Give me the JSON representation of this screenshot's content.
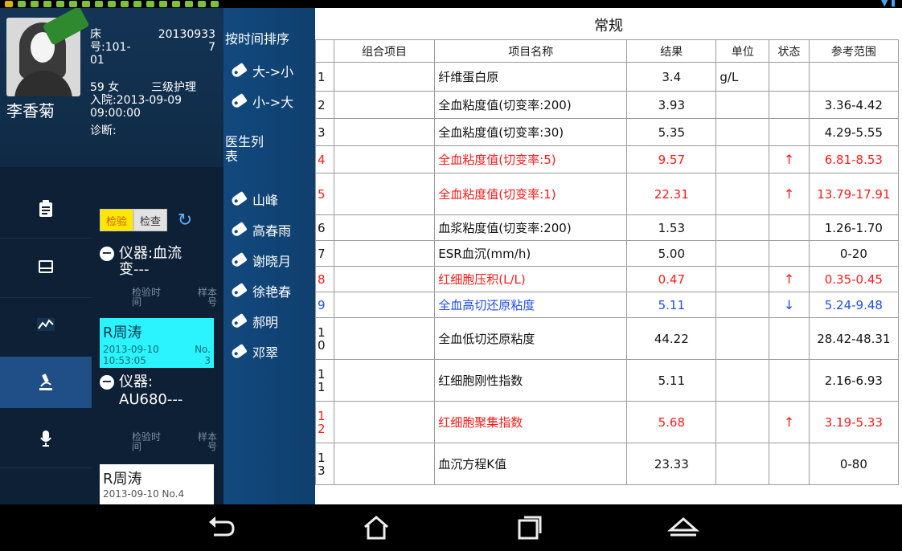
{
  "patient": {
    "name": "李香菊",
    "bed_label": "床",
    "bed_no": "号:101-",
    "bed_no2": "01",
    "pid": "20130933",
    "pid2": "7",
    "age_sex": "59 女",
    "care_level": "三级护理",
    "admit_label": "入院:2013-09-09",
    "admit_time": "09:00:00",
    "diagnosis_label": "诊断:"
  },
  "nav": {
    "icons": [
      "clipboard-icon",
      "inbox-icon",
      "trend-chart-icon",
      "microscope-icon",
      "microphone-icon"
    ]
  },
  "tests": {
    "tab_lab": "检验",
    "tab_exam": "检查",
    "instrument1_line1": "仪器:血流",
    "instrument1_line2": "变---",
    "instrument2_line1": "仪器:",
    "instrument2_line2": "AU680---",
    "col_time_1": "检验时",
    "col_time_2": "间",
    "col_sample_1": "样本",
    "col_sample_2": "号",
    "sample1": {
      "name": "R周涛",
      "date": "2013-09-10",
      "time": "10:53:05",
      "no1": "No.",
      "no2": "3"
    },
    "sample2": {
      "name": "R周涛",
      "date_partial": "2013-09-10 No.4"
    }
  },
  "filter": {
    "sort_title": "按时间排序",
    "sort_desc": "大->小",
    "sort_asc": "小->大",
    "doctor_title_1": "医生列",
    "doctor_title_2": "表",
    "doctors": [
      "山峰",
      "高春雨",
      "谢晓月",
      "徐艳春",
      "郝明",
      "邓翠"
    ]
  },
  "results": {
    "title": "常规",
    "headers": [
      "",
      "组合项目",
      "项目名称",
      "结果",
      "单位",
      "状态",
      "参考范围"
    ],
    "rows": [
      {
        "idx": "1",
        "name": "纤维蛋白原",
        "result": "3.4",
        "unit": "g/L",
        "status": "",
        "range": "",
        "color": "black"
      },
      {
        "idx": "2",
        "name": "全血粘度值(切变率:200)",
        "result": "3.93",
        "unit": "",
        "status": "",
        "range": "3.36-4.42",
        "color": "black"
      },
      {
        "idx": "3",
        "name": "全血粘度值(切变率:30)",
        "result": "5.35",
        "unit": "",
        "status": "",
        "range": "4.29-5.55",
        "color": "black"
      },
      {
        "idx": "4",
        "name": "全血粘度值(切变率:5)",
        "result": "9.57",
        "unit": "",
        "status": "↑",
        "range": "6.81-8.53",
        "color": "red"
      },
      {
        "idx": "5",
        "name": "全血粘度值(切变率:1)",
        "result": "22.31",
        "unit": "",
        "status": "↑",
        "range": "13.79-17.91",
        "color": "red"
      },
      {
        "idx": "6",
        "name": "血浆粘度值(切变率:200)",
        "result": "1.53",
        "unit": "",
        "status": "",
        "range": "1.26-1.70",
        "color": "black"
      },
      {
        "idx": "7",
        "name": "ESR血沉(mm/h)",
        "result": "5.00",
        "unit": "",
        "status": "",
        "range": "0-20",
        "color": "black"
      },
      {
        "idx": "8",
        "name": "红细胞压积(L/L)",
        "result": "0.47",
        "unit": "",
        "status": "↑",
        "range": "0.35-0.45",
        "color": "red"
      },
      {
        "idx": "9",
        "name": "全血高切还原粘度",
        "result": "5.11",
        "unit": "",
        "status": "↓",
        "range": "5.24-9.48",
        "color": "blue"
      },
      {
        "idx": "10",
        "name": "全血低切还原粘度",
        "result": "44.22",
        "unit": "",
        "status": "",
        "range": "28.42-48.31",
        "color": "black"
      },
      {
        "idx": "11",
        "name": "红细胞刚性指数",
        "result": "5.11",
        "unit": "",
        "status": "",
        "range": "2.16-6.93",
        "color": "black"
      },
      {
        "idx": "12",
        "name": "红细胞聚集指数",
        "result": "5.68",
        "unit": "",
        "status": "↑",
        "range": "3.19-5.33",
        "color": "red"
      },
      {
        "idx": "13",
        "name": "血沉方程K值",
        "result": "23.33",
        "unit": "",
        "status": "",
        "range": "0-80",
        "color": "black"
      }
    ]
  },
  "colors": {
    "high": "#ff1a1a",
    "low": "#1f4ee8",
    "selected_sample": "#2bf4ff",
    "active_tab": "#ffe800"
  }
}
